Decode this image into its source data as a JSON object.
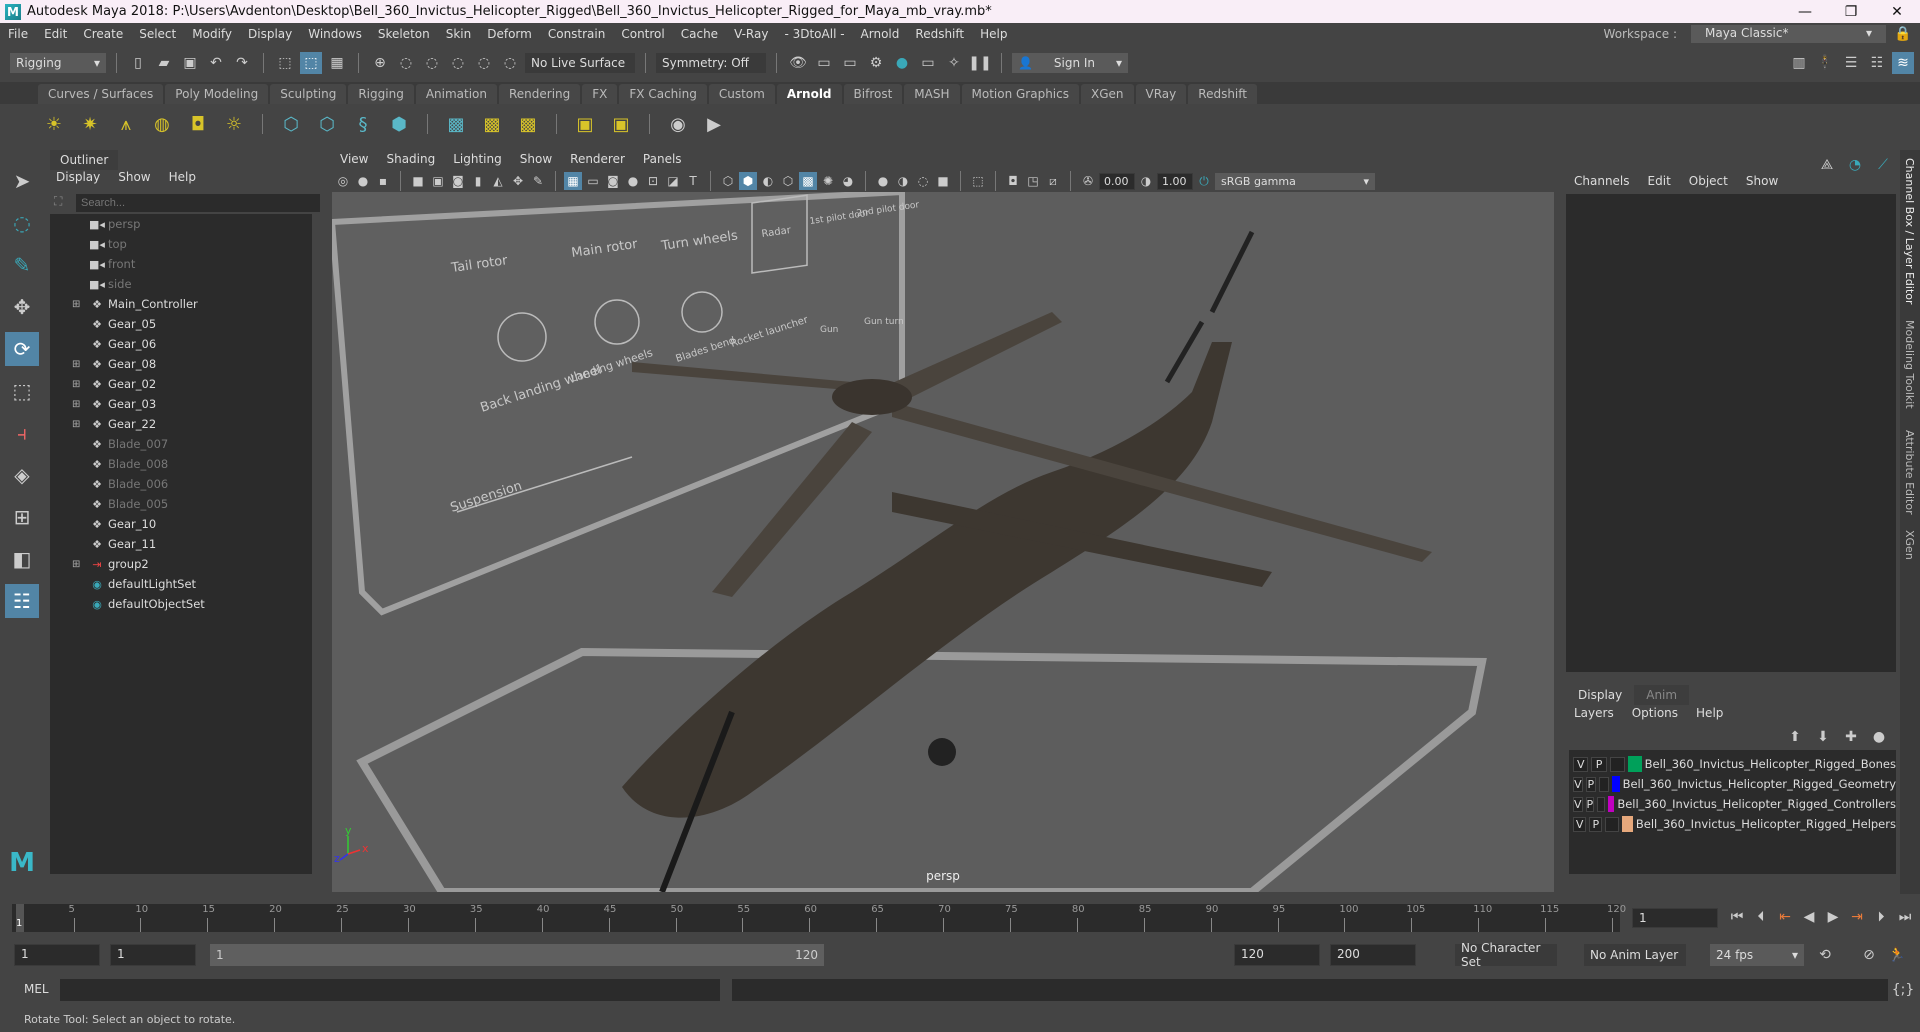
{
  "window": {
    "title": "Autodesk Maya 2018: P:\\Users\\Avdenton\\Desktop\\Bell_360_Invictus_Helicopter_Rigged\\Bell_360_Invictus_Helicopter_Rigged_for_Maya_mb_vray.mb*",
    "minimize": "—",
    "maximize": "❐",
    "close": "✕"
  },
  "menubar": {
    "items": [
      "File",
      "Edit",
      "Create",
      "Select",
      "Modify",
      "Display",
      "Windows",
      "Skeleton",
      "Skin",
      "Deform",
      "Constrain",
      "Control",
      "Cache",
      "V-Ray",
      "- 3DtoAll -",
      "Arnold",
      "Redshift",
      "Help"
    ],
    "workspace_label": "Workspace :",
    "workspace_value": "Maya Classic*"
  },
  "statusline": {
    "menuset": "Rigging",
    "live_surface": "No Live Surface",
    "symmetry": "Symmetry: Off",
    "sign_in": "Sign In"
  },
  "shelf": {
    "tabs": [
      "Curves / Surfaces",
      "Poly Modeling",
      "Sculpting",
      "Rigging",
      "Animation",
      "Rendering",
      "FX",
      "FX Caching",
      "Custom",
      "Arnold",
      "Bifrost",
      "MASH",
      "Motion Graphics",
      "XGen",
      "VRay",
      "Redshift"
    ],
    "active_tab": "Arnold"
  },
  "outliner": {
    "tab": "Outliner",
    "menu": [
      "Display",
      "Show",
      "Help"
    ],
    "search_placeholder": "Search...",
    "items": [
      {
        "name": "persp",
        "icon": "camera",
        "expandable": false,
        "dim": true
      },
      {
        "name": "top",
        "icon": "camera",
        "expandable": false,
        "dim": true
      },
      {
        "name": "front",
        "icon": "camera",
        "expandable": false,
        "dim": true
      },
      {
        "name": "side",
        "icon": "camera",
        "expandable": false,
        "dim": true
      },
      {
        "name": "Main_Controller",
        "icon": "transform",
        "expandable": true,
        "dim": false
      },
      {
        "name": "Gear_05",
        "icon": "transform",
        "expandable": false,
        "dim": false
      },
      {
        "name": "Gear_06",
        "icon": "transform",
        "expandable": false,
        "dim": false
      },
      {
        "name": "Gear_08",
        "icon": "transform",
        "expandable": true,
        "dim": false
      },
      {
        "name": "Gear_02",
        "icon": "transform",
        "expandable": true,
        "dim": false
      },
      {
        "name": "Gear_03",
        "icon": "transform",
        "expandable": true,
        "dim": false
      },
      {
        "name": "Gear_22",
        "icon": "transform",
        "expandable": true,
        "dim": false
      },
      {
        "name": "Blade_007",
        "icon": "transform",
        "expandable": false,
        "dim": true
      },
      {
        "name": "Blade_008",
        "icon": "transform",
        "expandable": false,
        "dim": true
      },
      {
        "name": "Blade_006",
        "icon": "transform",
        "expandable": false,
        "dim": true
      },
      {
        "name": "Blade_005",
        "icon": "transform",
        "expandable": false,
        "dim": true
      },
      {
        "name": "Gear_10",
        "icon": "transform",
        "expandable": false,
        "dim": false
      },
      {
        "name": "Gear_11",
        "icon": "transform",
        "expandable": false,
        "dim": false
      },
      {
        "name": "group2",
        "icon": "group",
        "expandable": true,
        "dim": false
      },
      {
        "name": "defaultLightSet",
        "icon": "set",
        "expandable": false,
        "dim": false
      },
      {
        "name": "defaultObjectSet",
        "icon": "set",
        "expandable": false,
        "dim": false
      }
    ]
  },
  "viewport": {
    "menu": [
      "View",
      "Shading",
      "Lighting",
      "Show",
      "Renderer",
      "Panels"
    ],
    "exposure": "0.00",
    "gamma": "1.00",
    "color_space": "sRGB gamma",
    "camera_label": "persp",
    "board_labels": [
      "Tail rotor",
      "Main rotor",
      "Turn wheels",
      "Radar",
      "1st pilot door",
      "2nd pilot door",
      "Back landing wheel",
      "Landing wheels",
      "Blades bend",
      "Rocket launcher",
      "Gun",
      "Gun turn",
      "Suspension"
    ],
    "axis": {
      "x": "x",
      "y": "y",
      "z": "z"
    }
  },
  "channelbox": {
    "menu": [
      "Channels",
      "Edit",
      "Object",
      "Show"
    ]
  },
  "layereditor": {
    "tabs": [
      "Display",
      "Anim"
    ],
    "menu": [
      "Layers",
      "Options",
      "Help"
    ],
    "layers": [
      {
        "v": "V",
        "p": "P",
        "color": "#00a05a",
        "name": "Bell_360_Invictus_Helicopter_Rigged_Bones"
      },
      {
        "v": "V",
        "p": "P",
        "color": "#0000ff",
        "name": "Bell_360_Invictus_Helicopter_Rigged_Geometry"
      },
      {
        "v": "V",
        "p": "P",
        "color": "#c000c0",
        "name": "Bell_360_Invictus_Helicopter_Rigged_Controllers"
      },
      {
        "v": "V",
        "p": "P",
        "color": "#e6a87c",
        "name": "Bell_360_Invictus_Helicopter_Rigged_Helpers"
      }
    ]
  },
  "side_tabs": [
    "Channel Box / Layer Editor",
    "Modeling Toolkit",
    "Attribute Editor",
    "XGen"
  ],
  "timeline": {
    "ticks": [
      "5",
      "10",
      "15",
      "20",
      "25",
      "30",
      "35",
      "40",
      "45",
      "50",
      "55",
      "60",
      "65",
      "70",
      "75",
      "80",
      "85",
      "90",
      "95",
      "100",
      "105",
      "110",
      "115",
      "120"
    ],
    "current_frame": "1",
    "current_frame_field": "1"
  },
  "range": {
    "start": "1",
    "playback_start": "1",
    "slider_start": "1",
    "slider_end": "120",
    "playback_end": "120",
    "end": "200",
    "character_set": "No Character Set",
    "anim_layer": "No Anim Layer",
    "fps": "24 fps"
  },
  "cmdline": {
    "label": "MEL"
  },
  "helpline": {
    "text": "Rotate Tool: Select an object to rotate."
  }
}
